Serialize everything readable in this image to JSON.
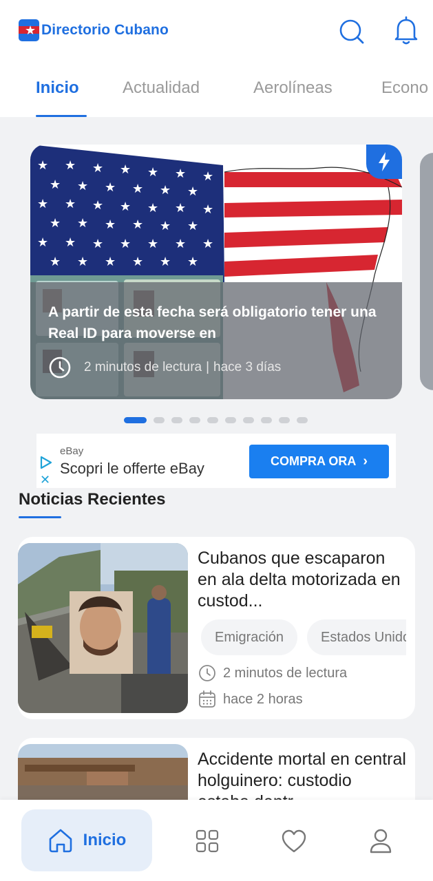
{
  "header": {
    "app_title": "Directorio Cubano",
    "logo_icon": "cuban-flag-star-logo",
    "search_icon": "search-icon",
    "notifications_icon": "bell-icon"
  },
  "tabs": [
    {
      "label": "Inicio",
      "active": true
    },
    {
      "label": "Actualidad",
      "active": false
    },
    {
      "label": "Aerolíneas",
      "active": false
    },
    {
      "label": "Econo",
      "active": false
    }
  ],
  "carousel": {
    "title": "A partir de esta fecha será obligatorio tener una Real ID para moverse en",
    "read_time": "2 minutos de lectura",
    "separator": "|",
    "posted": "hace 3 días",
    "badge_icon": "lightning-icon",
    "page_count": 10,
    "active_index": 0
  },
  "ad": {
    "source": "eBay",
    "text": "Scopri le offerte eBay",
    "cta_label": "COMPRA ORA",
    "cta_icon": "chevron-right-icon"
  },
  "section": {
    "title": "Noticias Recientes"
  },
  "articles": [
    {
      "title": "Cubanos que escaparon en ala delta motorizada en custod...",
      "tags": [
        "Emigración",
        "Estados Unidos"
      ],
      "read_time": "2 minutos de lectura",
      "posted": "hace 2 horas"
    },
    {
      "title": "Accidente mortal en central holguinero: custodio estaba dentr..."
    }
  ],
  "bottom_nav": {
    "home_label": "Inicio",
    "items": [
      "home-icon",
      "categories-grid-icon",
      "favorites-heart-icon",
      "profile-icon"
    ]
  },
  "colors": {
    "accent": "#1f6fe0",
    "ad_cta": "#1a7ff0",
    "flag_red": "#d72631"
  }
}
